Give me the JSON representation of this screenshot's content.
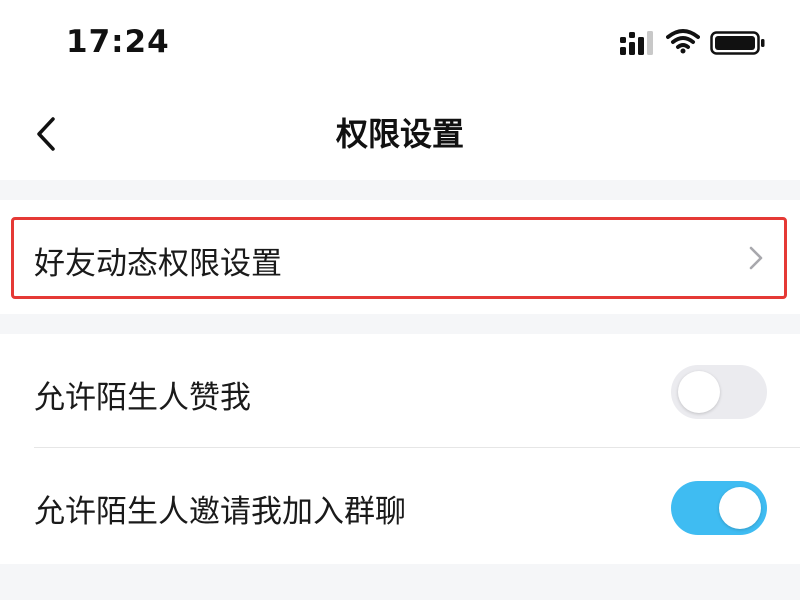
{
  "status_bar": {
    "time": "17:24",
    "icons": [
      "signal-icon",
      "wifi-icon",
      "battery-icon"
    ]
  },
  "nav": {
    "title": "权限设置",
    "back_icon": "chevron-left-icon"
  },
  "settings": {
    "friends_feed": {
      "label": "好友动态权限设置",
      "icon": "chevron-right-icon",
      "highlighted": true,
      "highlight_color": "#e53935"
    },
    "allow_stranger_like": {
      "label": "允许陌生人赞我",
      "enabled": false
    },
    "allow_stranger_group_invite": {
      "label": "允许陌生人邀请我加入群聊",
      "enabled": true
    }
  },
  "colors": {
    "toggle_on": "#3fbcf2",
    "toggle_off": "#ebebef",
    "page_background": "#f5f6f8"
  }
}
